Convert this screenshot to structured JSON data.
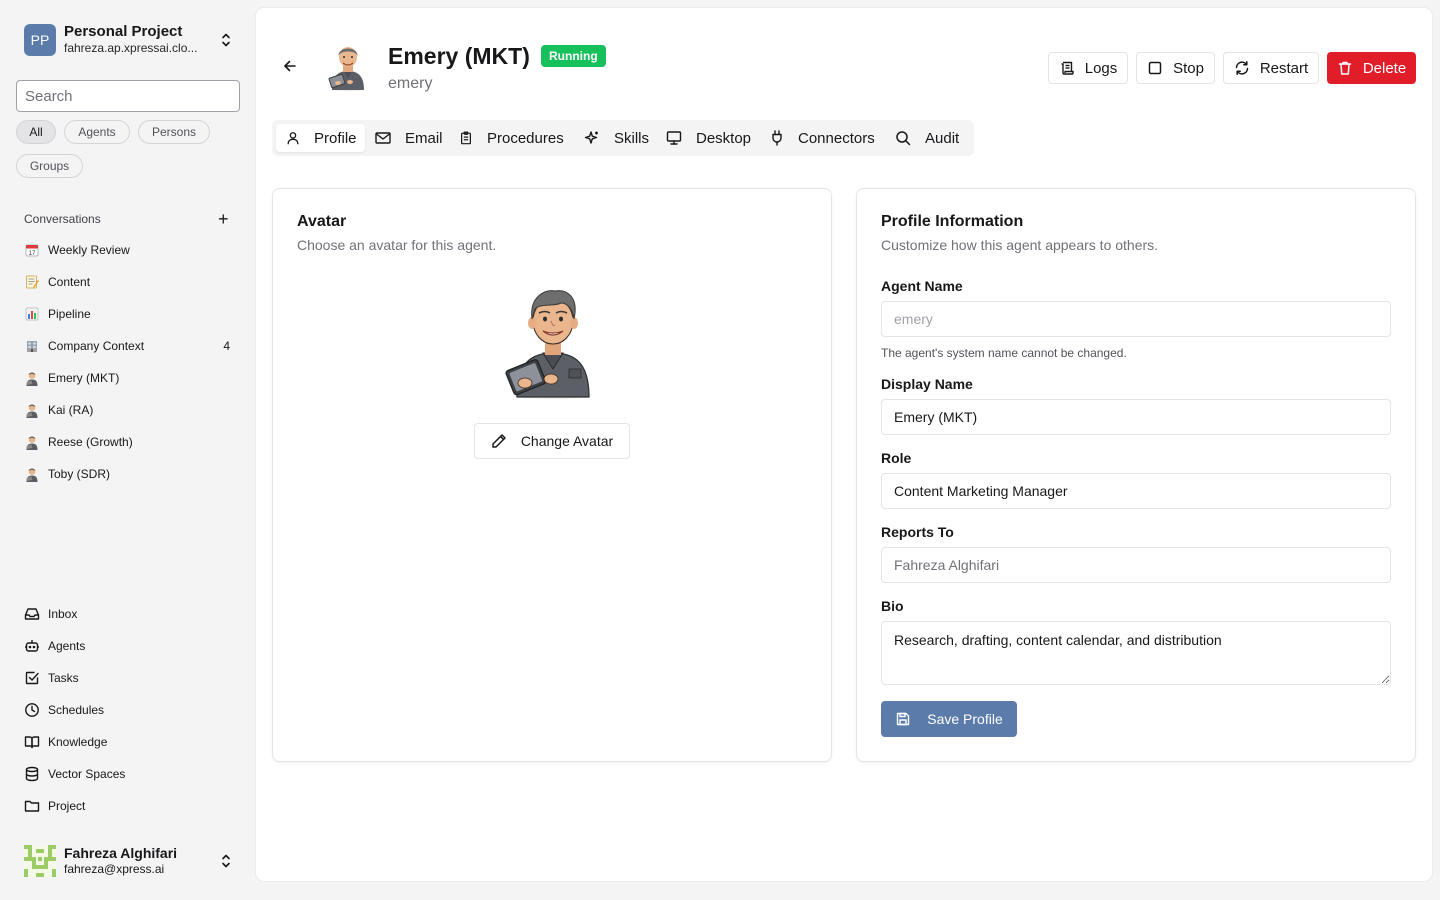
{
  "project": {
    "initials": "PP",
    "name": "Personal Project",
    "domain": "fahreza.ap.xpressai.clo..."
  },
  "search": {
    "placeholder": "Search"
  },
  "filters": [
    "All",
    "Agents",
    "Persons",
    "Groups"
  ],
  "conversations": {
    "title": "Conversations",
    "items": [
      {
        "label": "Weekly Review",
        "icon": "calendar-icon"
      },
      {
        "label": "Content",
        "icon": "memo-icon"
      },
      {
        "label": "Pipeline",
        "icon": "bar-chart-icon"
      },
      {
        "label": "Company Context",
        "icon": "building-icon",
        "count": "4"
      },
      {
        "label": "Emery (MKT)",
        "icon": "agent-avatar-icon"
      },
      {
        "label": "Kai (RA)",
        "icon": "agent-avatar-icon"
      },
      {
        "label": "Reese (Growth)",
        "icon": "agent-avatar-icon"
      },
      {
        "label": "Toby (SDR)",
        "icon": "agent-avatar-icon"
      }
    ]
  },
  "nav": [
    {
      "label": "Inbox",
      "icon": "inbox-icon"
    },
    {
      "label": "Agents",
      "icon": "bot-icon"
    },
    {
      "label": "Tasks",
      "icon": "check-square-icon"
    },
    {
      "label": "Schedules",
      "icon": "clock-icon"
    },
    {
      "label": "Knowledge",
      "icon": "book-icon"
    },
    {
      "label": "Vector Spaces",
      "icon": "database-icon"
    },
    {
      "label": "Project",
      "icon": "folder-icon"
    }
  ],
  "user": {
    "name": "Fahreza Alghifari",
    "email": "fahreza@xpress.ai"
  },
  "agent": {
    "display_name": "Emery (MKT)",
    "status": "Running",
    "system_name": "emery"
  },
  "actions": {
    "logs": "Logs",
    "stop": "Stop",
    "restart": "Restart",
    "delete": "Delete"
  },
  "tabs": [
    "Profile",
    "Email",
    "Procedures",
    "Skills",
    "Desktop",
    "Connectors",
    "Audit"
  ],
  "avatar_card": {
    "title": "Avatar",
    "subtitle": "Choose an avatar for this agent.",
    "button": "Change Avatar"
  },
  "profile_card": {
    "title": "Profile Information",
    "subtitle": "Customize how this agent appears to others.",
    "agent_name_label": "Agent Name",
    "agent_name_value": "emery",
    "agent_name_hint": "The agent's system name cannot be changed.",
    "display_name_label": "Display Name",
    "display_name_value": "Emery (MKT)",
    "role_label": "Role",
    "role_value": "Content Marketing Manager",
    "reports_to_label": "Reports To",
    "reports_to_placeholder": "Fahreza Alghifari",
    "bio_label": "Bio",
    "bio_value": "Research, drafting, content calendar, and distribution",
    "save_button": "Save Profile"
  },
  "colors": {
    "accent": "#5b7bab",
    "running": "#16c05b",
    "danger": "#e11d2a"
  }
}
